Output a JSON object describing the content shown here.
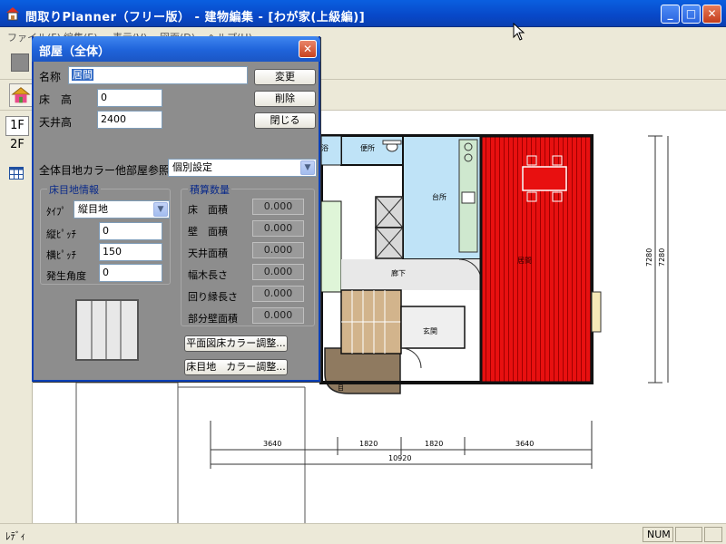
{
  "window": {
    "title": "間取りPlanner（フリー版） - 建物編集 - [わが家(上級編)]",
    "min_label": "_",
    "max_label": "□",
    "close_label": "✕"
  },
  "menu": {
    "items": [
      "ファイル(F)",
      "編集(E)",
      "表示(V)",
      "図面(D)",
      "ヘルプ(H)"
    ]
  },
  "floors": {
    "tabs": [
      "1F",
      "2F"
    ],
    "active": "1F"
  },
  "dialog": {
    "title": "部屋（全体）",
    "close_label": "✕",
    "name_label": "名称",
    "name_value": "居間",
    "floor_height_label": "床　高",
    "floor_height_value": "0",
    "ceiling_height_label": "天井高",
    "ceiling_height_value": "2400",
    "btn_change": "変更",
    "btn_delete": "削除",
    "btn_close": "閉じる",
    "color_ref_label": "全体目地カラー他部屋参照",
    "color_ref_value": "個別設定",
    "joint_group": {
      "title": "床目地情報",
      "type_label": "ﾀｲﾌﾟ",
      "type_value": "縦目地",
      "vpitch_label": "縦ﾋﾟｯﾁ",
      "vpitch_value": "0",
      "hpitch_label": "横ﾋﾟｯﾁ",
      "hpitch_value": "150",
      "angle_label": "発生角度",
      "angle_value": "0"
    },
    "quantity_group": {
      "title": "積算数量",
      "rows": [
        {
          "label": "床　面積",
          "value": "0.000"
        },
        {
          "label": "壁　面積",
          "value": "0.000"
        },
        {
          "label": "天井面積",
          "value": "0.000"
        },
        {
          "label": "幅木長さ",
          "value": "0.000"
        },
        {
          "label": "回り縁長さ",
          "value": "0.000"
        },
        {
          "label": "部分壁面積",
          "value": "0.000"
        }
      ]
    },
    "btn_plan_floor_color": "平面図床カラー調整...",
    "btn_joint_color": "床目地　カラー調整..."
  },
  "plan": {
    "rooms": {
      "toilet": "便所",
      "kitchen": "台所",
      "living": "居間",
      "hall": "廊下",
      "entrance": "玄関",
      "bath_partial": "浴"
    },
    "dims": {
      "segments": [
        "3640",
        "1820",
        "1820",
        "3640"
      ],
      "total": "10920",
      "right_1": "7280",
      "right_2": "7280"
    },
    "living_color": "#e81010"
  },
  "status": {
    "text": "ﾚﾃﾞｨ",
    "num": "NUM"
  },
  "colors": {
    "titlebar": "#0a52d8",
    "dialog_bg": "#8d8d8d",
    "living": "#e81010",
    "kitchen": "#bfe3f7",
    "toilet": "#bfe3f7",
    "stairs": "#d2b48c",
    "porch": "#8f7a60"
  }
}
